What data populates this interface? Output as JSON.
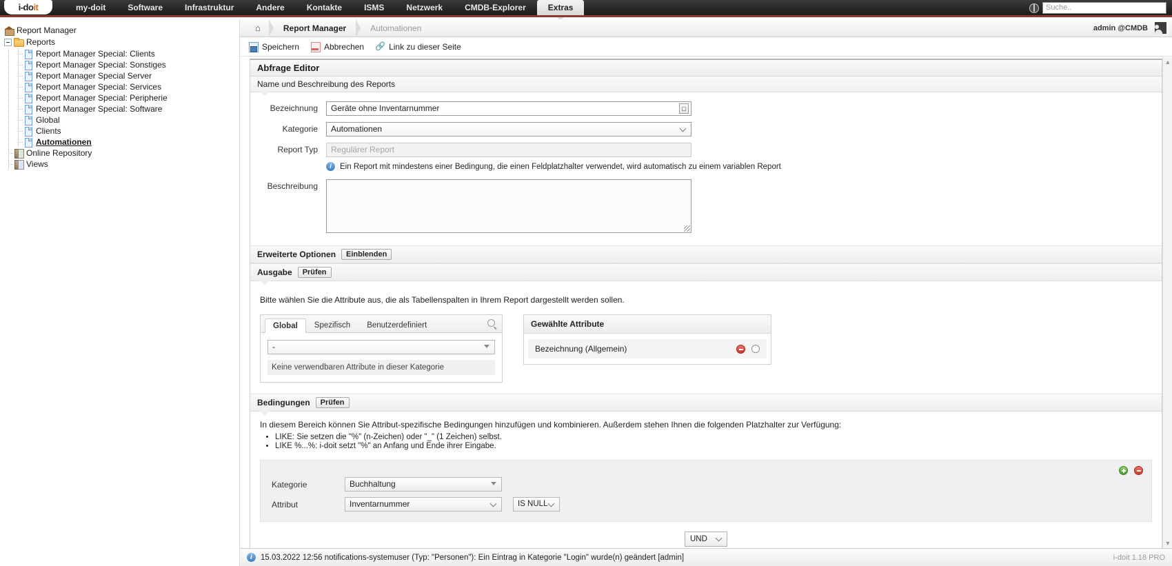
{
  "topnav": {
    "logo": {
      "left": "i-do",
      "right": "it"
    },
    "items": [
      {
        "label": "my-doit",
        "active": false
      },
      {
        "label": "Software",
        "active": false
      },
      {
        "label": "Infrastruktur",
        "active": false
      },
      {
        "label": "Andere",
        "active": false
      },
      {
        "label": "Kontakte",
        "active": false
      },
      {
        "label": "ISMS",
        "active": false
      },
      {
        "label": "Netzwerk",
        "active": false
      },
      {
        "label": "CMDB-Explorer",
        "active": false
      },
      {
        "label": "Extras",
        "active": true
      }
    ],
    "search_placeholder": "Suche..",
    "globe_icon": "globe-icon"
  },
  "sidebar": {
    "root": {
      "label": "Report Manager",
      "icon": "home-icon"
    },
    "folder": {
      "label": "Reports",
      "icon": "folder-icon"
    },
    "reports": [
      {
        "label": "Report Manager Special: Clients",
        "icon": "document-icon",
        "selected": false
      },
      {
        "label": "Report Manager Special: Sonstiges",
        "icon": "document-icon",
        "selected": false
      },
      {
        "label": "Report Manager Special Server",
        "icon": "document-icon",
        "selected": false
      },
      {
        "label": "Report Manager Special: Services",
        "icon": "document-icon",
        "selected": false
      },
      {
        "label": "Report Manager Special: Peripherie",
        "icon": "document-icon",
        "selected": false
      },
      {
        "label": "Report Manager Special: Software",
        "icon": "document-icon",
        "selected": false
      },
      {
        "label": "Global",
        "icon": "document-icon",
        "selected": false
      },
      {
        "label": "Clients",
        "icon": "document-icon",
        "selected": false
      },
      {
        "label": "Automationen",
        "icon": "document-icon",
        "selected": true
      }
    ],
    "extras": [
      {
        "label": "Online Repository",
        "icon": "repository-icon"
      },
      {
        "label": "Views",
        "icon": "views-icon"
      }
    ]
  },
  "breadcrumb": {
    "home_icon": "home-icon",
    "current": "Report Manager",
    "sub": "Automationen",
    "user": "admin  @CMDB",
    "avatar_icon": "user-avatar-icon"
  },
  "toolbar": {
    "save_label": "Speichern",
    "cancel_label": "Abbrechen",
    "link_label": "Link zu dieser Seite",
    "link_icon": "chain-link-icon"
  },
  "editor": {
    "title": "Abfrage Editor",
    "section_name": "Name und Beschreibung des Reports",
    "fields": {
      "bezeichnung_label": "Bezeichnung",
      "bezeichnung_value": "Geräte ohne Inventarnummer",
      "kategorie_label": "Kategorie",
      "kategorie_value": "Automationen",
      "reporttyp_label": "Report Typ",
      "reporttyp_value": "Regulärer Report",
      "beschreibung_label": "Beschreibung",
      "beschreibung_value": ""
    },
    "info_text": "Ein Report mit mindestens einer Bedingung, die einen Feldplatzhalter verwendet, wird automatisch zu einem variablen Report"
  },
  "advanced": {
    "label": "Erweiterte Optionen",
    "button": "Einblenden"
  },
  "ausgabe": {
    "label": "Ausgabe",
    "button": "Prüfen",
    "hint": "Bitte wählen Sie die Attribute aus, die als Tabellenspalten in Ihrem Report dargestellt werden sollen.",
    "tabs": [
      {
        "label": "Global",
        "active": true
      },
      {
        "label": "Spezifisch",
        "active": false
      },
      {
        "label": "Benutzerdefiniert",
        "active": false
      }
    ],
    "search_icon": "magnifier-icon",
    "category_select_value": "-",
    "empty_message": "Keine verwendbaren Attribute in dieser Kategorie",
    "chosen_header": "Gewählte Attribute",
    "chosen_items": [
      {
        "label": "Bezeichnung (Allgemein)",
        "remove_icon": "remove-circle-icon",
        "radio_icon": "radio-circle-icon"
      }
    ]
  },
  "bedingungen": {
    "label": "Bedingungen",
    "button": "Prüfen",
    "intro": "In diesem Bereich können Sie Attribut-spezifische Bedingungen hinzufügen und kombinieren. Außerdem stehen Ihnen die folgenden Platzhalter zur Verfügung:",
    "bullets": [
      "LIKE: Sie setzen die \"%\" (n-Zeichen) oder \"_\" (1 Zeichen) selbst.",
      "LIKE %...%: i-doit setzt \"%\" an Anfang und Ende ihrer Eingabe."
    ],
    "condition": {
      "kategorie_label": "Kategorie",
      "kategorie_value": "Buchhaltung",
      "attribut_label": "Attribut",
      "attribut_value": "Inventarnummer",
      "operator_value": "IS NULL",
      "add_icon": "add-circle-icon",
      "remove_icon": "remove-circle-icon"
    },
    "logic_value": "UND"
  },
  "statusbar": {
    "icon": "info-icon",
    "message": "15.03.2022 12:56 notifications-systemuser (Typ: \"Personen\"): Ein Eintrag in Kategorie \"Login\" wurde(n) geändert [admin]",
    "version": "i-doit 1.18 PRO"
  }
}
